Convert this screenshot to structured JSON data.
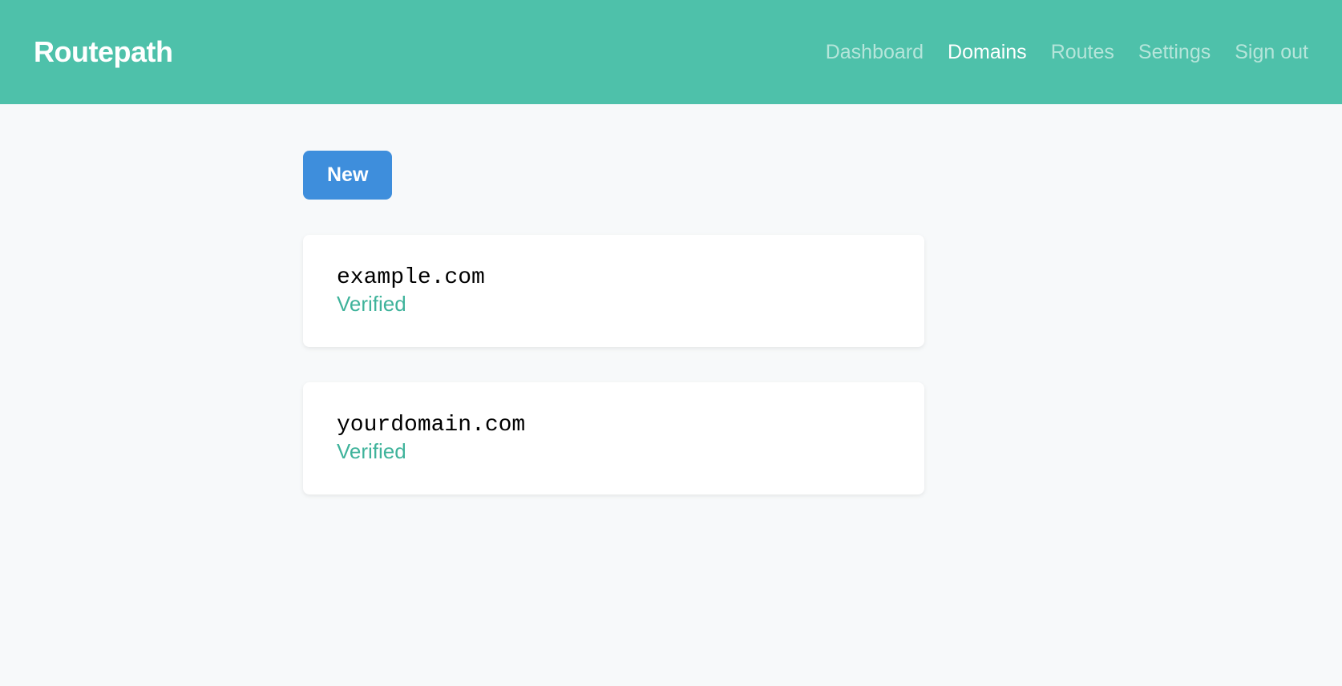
{
  "header": {
    "logo": "Routepath",
    "nav": [
      {
        "label": "Dashboard",
        "active": false
      },
      {
        "label": "Domains",
        "active": true
      },
      {
        "label": "Routes",
        "active": false
      },
      {
        "label": "Settings",
        "active": false
      },
      {
        "label": "Sign out",
        "active": false
      }
    ]
  },
  "actions": {
    "new_label": "New"
  },
  "domains": [
    {
      "name": "example.com",
      "status": "Verified"
    },
    {
      "name": "yourdomain.com",
      "status": "Verified"
    }
  ],
  "colors": {
    "brand": "#4ec1aa",
    "accent": "#3e8edc",
    "status_verified": "#3fb39b"
  }
}
